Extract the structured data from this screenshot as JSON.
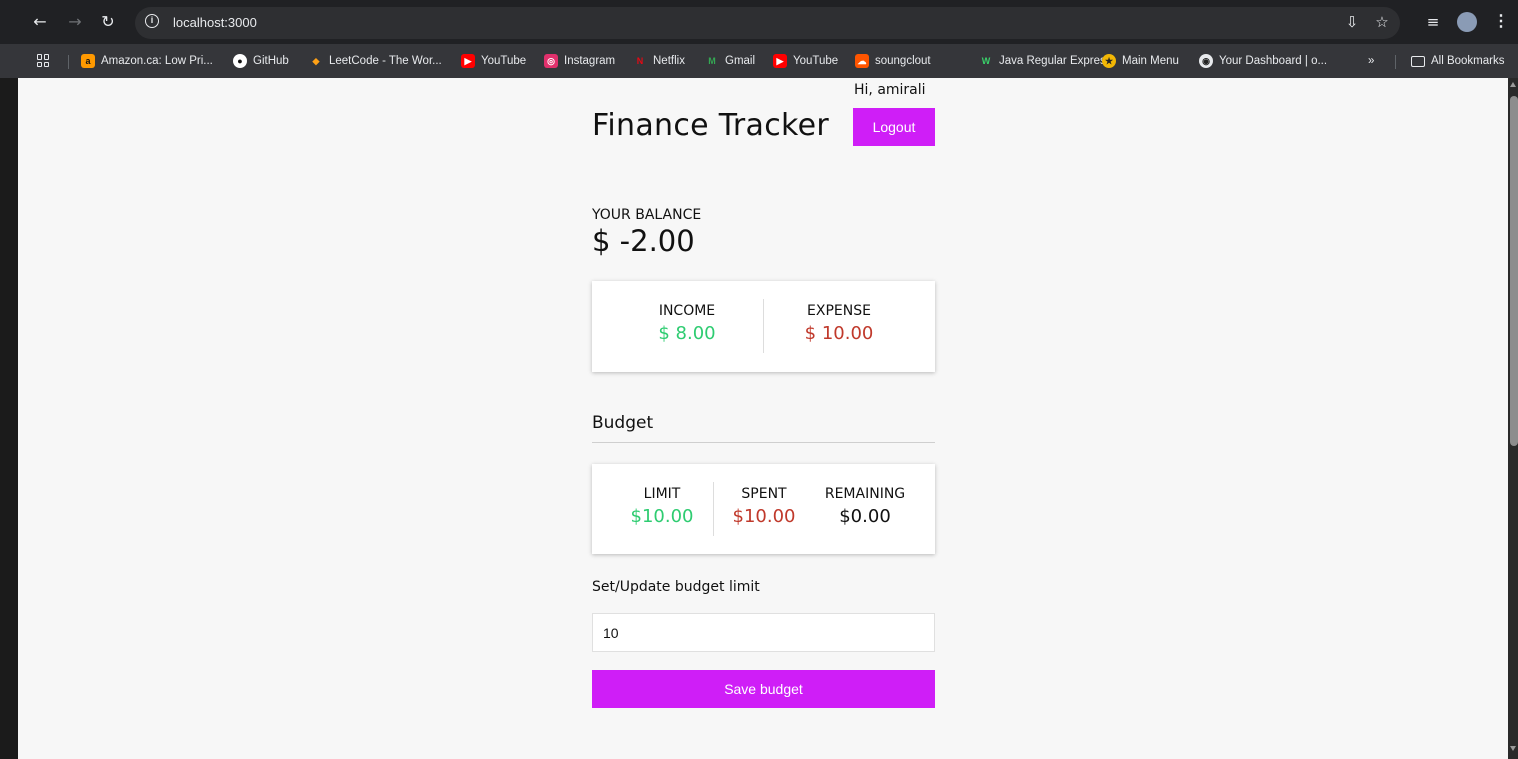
{
  "browser": {
    "url": "localhost:3000",
    "bookmarks": [
      {
        "label": "Amazon.ca: Low Pri...",
        "icon": "amazon-icon",
        "color": "#ff9900"
      },
      {
        "label": "GitHub",
        "icon": "github-icon",
        "color": "#ffffff"
      },
      {
        "label": "LeetCode - The Wor...",
        "icon": "leetcode-icon",
        "color": "#ffa116"
      },
      {
        "label": "YouTube",
        "icon": "youtube-icon",
        "color": "#ff0000"
      },
      {
        "label": "Instagram",
        "icon": "instagram-icon",
        "color": "#e1306c"
      },
      {
        "label": "Netflix",
        "icon": "netflix-icon",
        "color": "#e50914"
      },
      {
        "label": "Gmail",
        "icon": "gmail-icon",
        "color": "#34a853"
      },
      {
        "label": "YouTube",
        "icon": "youtube-icon",
        "color": "#ff0000"
      },
      {
        "label": "soungclout",
        "icon": "soundcloud-icon",
        "color": "#ff5500"
      },
      {
        "label": "Java Regular Expres...",
        "icon": "w-icon",
        "color": "#3ad06a"
      },
      {
        "label": "Main Menu",
        "icon": "main-menu-icon",
        "color": "#f2b705"
      },
      {
        "label": "Your Dashboard | o...",
        "icon": "dashboard-icon",
        "color": "#222222"
      }
    ],
    "overflow_label": "»",
    "all_bookmarks_label": "All Bookmarks"
  },
  "app": {
    "title": "Finance Tracker",
    "greeting": "Hi, amirali",
    "logout_label": "Logout",
    "balance_label": "YOUR BALANCE",
    "balance_value": "$ -2.00",
    "income_label": "INCOME",
    "income_value": "$ 8.00",
    "expense_label": "EXPENSE",
    "expense_value": "$ 10.00",
    "budget_heading": "Budget",
    "limit_label": "LIMIT",
    "limit_value": "$10.00",
    "spent_label": "SPENT",
    "spent_value": "$10.00",
    "remaining_label": "REMAINING",
    "remaining_value": "$0.00",
    "set_limit_label": "Set/Update budget limit",
    "limit_input_value": "10",
    "save_label": "Save budget"
  },
  "colors": {
    "accent": "#cf1ef7",
    "positive": "#2ecc71",
    "negative": "#c0392b"
  }
}
